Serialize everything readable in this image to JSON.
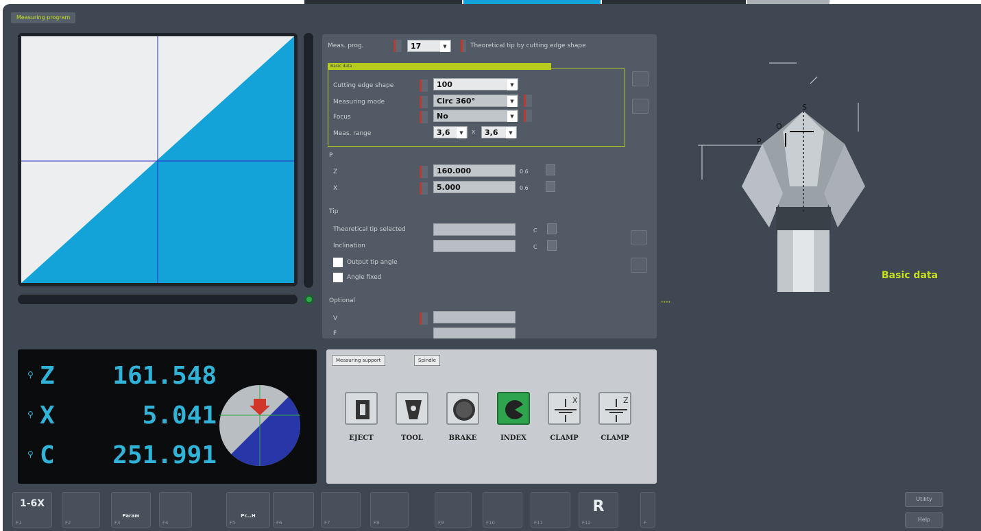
{
  "program_tag": "Measuring program",
  "params": {
    "header_label": "Meas. prog.",
    "header_value": "17",
    "header_desc": "Theoretical tip by cutting edge shape",
    "basic_tab": "Basic data",
    "rows": [
      {
        "label": "Cutting edge shape",
        "value": "100"
      },
      {
        "label": "Measuring mode",
        "value": "Circ 360°"
      },
      {
        "label": "Focus",
        "value": "No"
      },
      {
        "label": "Meas. range",
        "value": "3,6",
        "value2": "3,6",
        "sep": "x"
      }
    ],
    "pos_section": "P",
    "pos_rows": [
      {
        "label": "Z",
        "value": "160.000",
        "unit": "0.6"
      },
      {
        "label": "X",
        "value": "5.000",
        "unit": "0.6"
      }
    ],
    "tip_section": "Tip",
    "tip_rows": [
      {
        "label": "Theoretical tip selected",
        "value": "",
        "unit": "C"
      },
      {
        "label": "Inclination",
        "value": "",
        "unit": "C"
      }
    ],
    "checks": [
      "Output tip angle",
      "Angle fixed"
    ],
    "optional_section": "Optional",
    "optional_rows": [
      {
        "label": "V",
        "value": ""
      },
      {
        "label": "F",
        "value": ""
      }
    ]
  },
  "dro": {
    "axes": [
      {
        "name": "Z",
        "value": "161.548"
      },
      {
        "name": "X",
        "value": "5.041"
      },
      {
        "name": "C",
        "value": "251.991"
      }
    ]
  },
  "io": {
    "tabs": [
      "Measuring support",
      "Spindle"
    ],
    "buttons": [
      {
        "label": "EJECT",
        "active": false
      },
      {
        "label": "TOOL",
        "active": false
      },
      {
        "label": "BRAKE",
        "active": false
      },
      {
        "label": "INDEX",
        "active": true
      },
      {
        "label": "CLAMP",
        "active": false,
        "axis": "X"
      },
      {
        "label": "CLAMP",
        "active": false,
        "axis": "Z"
      }
    ]
  },
  "fkeys": [
    {
      "label": "F1",
      "icon": "1-6X"
    },
    {
      "label": "F2",
      "icon": ""
    },
    {
      "label": "F3",
      "icon": "Param"
    },
    {
      "label": "F4",
      "icon": ""
    },
    {
      "label": "F5",
      "icon": "Pr...H"
    },
    {
      "label": "F6",
      "icon": ""
    },
    {
      "label": "F7",
      "icon": ""
    },
    {
      "label": "F8",
      "icon": ""
    },
    {
      "label": "F9",
      "icon": ""
    },
    {
      "label": "F10",
      "icon": ""
    },
    {
      "label": "F11",
      "icon": ""
    },
    {
      "label": "F12",
      "icon": "R"
    }
  ],
  "side_key": "F",
  "right_buttons": [
    "Utility",
    "Help"
  ],
  "basic_data_title": "Basic data",
  "tool_labels": {
    "s": "S",
    "o": "O",
    "p": "P"
  },
  "colors": {
    "accent": "#c6e01e",
    "cyan": "#14a3d8",
    "active": "#2ea44f",
    "bg": "#3f4852"
  }
}
